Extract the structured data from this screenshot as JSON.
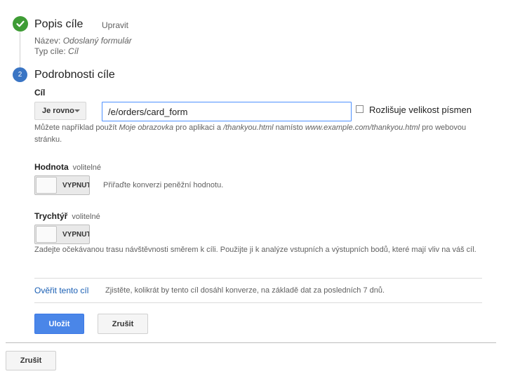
{
  "step1": {
    "title": "Popis cíle",
    "edit_label": "Upravit",
    "name_label": "Název:",
    "name_value": "Odoslaný formulár",
    "type_label": "Typ cíle:",
    "type_value": "Cíl"
  },
  "step2": {
    "number": "2",
    "title": "Podrobnosti cíle",
    "goal_label": "Cíl",
    "match_type": "Je rovno",
    "url_value": "/e/orders/card_form",
    "case_sensitive_label": "Rozlišuje velikost písmen",
    "case_sensitive_checked": false,
    "help": {
      "p1": "Můžete například použít ",
      "i1": "Moje obrazovka",
      "p2": " pro aplikaci a ",
      "i2": "/thankyou.html",
      "p3": " namísto ",
      "i3": "www.example.com/thankyou.html",
      "p4": " pro webovou stránku."
    },
    "value": {
      "label": "Hodnota",
      "optional": "volitelné",
      "toggle_state": "VYPNUTO",
      "description": "Přiřaďte konverzi peněžní hodnotu."
    },
    "funnel": {
      "label": "Trychtýř",
      "optional": "volitelné",
      "toggle_state": "VYPNUTO",
      "description": "Zadejte očekávanou trasu návštěvnosti směrem k cíli. Použijte ji k analýze vstupních a výstupních bodů, které mají vliv na váš cíl."
    },
    "verify": {
      "link": "Ověřit tento cíl",
      "description": "Zjistěte, kolikrát by tento cíl dosáhl konverze, na základě dat za posledních 7 dnů."
    },
    "save_button": "Uložit",
    "cancel_button": "Zrušit"
  },
  "footer": {
    "cancel_button": "Zrušit"
  },
  "colors": {
    "step_done": "#3e9c35",
    "step_active": "#3a75c4",
    "primary_button": "#4a86e8",
    "link": "#1a5fb4"
  },
  "icons": {
    "step1": "checkmark-icon",
    "select": "caret-down-icon"
  }
}
